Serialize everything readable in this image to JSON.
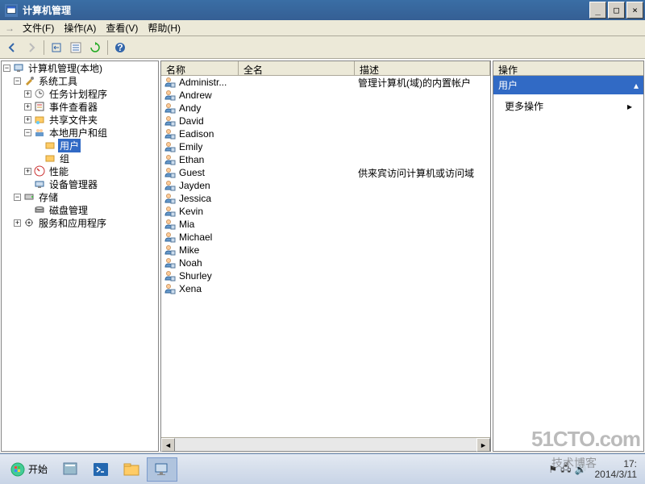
{
  "window": {
    "title": "计算机管理",
    "btn_min": "_",
    "btn_max": "□",
    "btn_close": "×"
  },
  "menu": {
    "file": "文件(F)",
    "action": "操作(A)",
    "view": "查看(V)",
    "help": "帮助(H)"
  },
  "tree": {
    "root": "计算机管理(本地)",
    "systools": "系统工具",
    "taskscheduler": "任务计划程序",
    "eventviewer": "事件查看器",
    "sharedfolders": "共享文件夹",
    "localusers": "本地用户和组",
    "users": "用户",
    "groups": "组",
    "performance": "性能",
    "devmgr": "设备管理器",
    "storage": "存储",
    "diskadmin": "磁盘管理",
    "services": "服务和应用程序"
  },
  "list": {
    "cols": {
      "name": "名称",
      "fullname": "全名",
      "desc": "描述"
    },
    "rows": [
      {
        "name": "Administr...",
        "fullname": "",
        "desc": "管理计算机(域)的内置帐户"
      },
      {
        "name": "Andrew",
        "fullname": "",
        "desc": ""
      },
      {
        "name": "Andy",
        "fullname": "",
        "desc": ""
      },
      {
        "name": "David",
        "fullname": "",
        "desc": ""
      },
      {
        "name": "Eadison",
        "fullname": "",
        "desc": ""
      },
      {
        "name": "Emily",
        "fullname": "",
        "desc": ""
      },
      {
        "name": "Ethan",
        "fullname": "",
        "desc": ""
      },
      {
        "name": "Guest",
        "fullname": "",
        "desc": "供来宾访问计算机或访问域"
      },
      {
        "name": "Jayden",
        "fullname": "",
        "desc": ""
      },
      {
        "name": "Jessica",
        "fullname": "",
        "desc": ""
      },
      {
        "name": "Kevin",
        "fullname": "",
        "desc": ""
      },
      {
        "name": "Mia",
        "fullname": "",
        "desc": ""
      },
      {
        "name": "Michael",
        "fullname": "",
        "desc": ""
      },
      {
        "name": "Mike",
        "fullname": "",
        "desc": ""
      },
      {
        "name": "Noah",
        "fullname": "",
        "desc": ""
      },
      {
        "name": "Shurley",
        "fullname": "",
        "desc": ""
      },
      {
        "name": "Xena",
        "fullname": "",
        "desc": ""
      }
    ]
  },
  "actions": {
    "title": "操作",
    "section": "用户",
    "more": "更多操作"
  },
  "taskbar": {
    "start": "开始",
    "time": "17:",
    "date": "2014/3/11"
  },
  "watermark": "51CTO.com",
  "watermark2": "技术博客"
}
